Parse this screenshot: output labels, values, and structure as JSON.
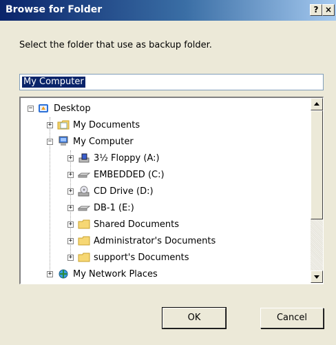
{
  "window": {
    "title": "Browse for Folder",
    "help_label": "?",
    "close_label": "×"
  },
  "instruction": "Select the folder that use as backup folder.",
  "selected_path": "My Computer",
  "tree": {
    "items": [
      {
        "label": "Desktop",
        "expander": "−",
        "icon": "desktop-icon"
      },
      {
        "label": "My Documents",
        "expander": "+",
        "icon": "my-documents-icon"
      },
      {
        "label": "My Computer",
        "expander": "−",
        "icon": "my-computer-icon"
      },
      {
        "label": "3½ Floppy (A:)",
        "expander": "+",
        "icon": "floppy-drive-icon"
      },
      {
        "label": "EMBEDDED (C:)",
        "expander": "+",
        "icon": "hard-drive-icon"
      },
      {
        "label": "CD Drive (D:)",
        "expander": "+",
        "icon": "cd-drive-icon"
      },
      {
        "label": "DB-1 (E:)",
        "expander": "+",
        "icon": "hard-drive-icon"
      },
      {
        "label": "Shared Documents",
        "expander": "+",
        "icon": "folder-icon"
      },
      {
        "label": "Administrator's Documents",
        "expander": "+",
        "icon": "folder-icon"
      },
      {
        "label": "support's Documents",
        "expander": "+",
        "icon": "folder-icon"
      },
      {
        "label": "My Network Places",
        "expander": "+",
        "icon": "network-places-icon"
      }
    ]
  },
  "buttons": {
    "ok": "OK",
    "cancel": "Cancel"
  },
  "colors": {
    "titlebar_start": "#0a246a",
    "titlebar_end": "#a6caf0",
    "dialog_bg": "#ece9d8",
    "selection": "#0a246a"
  }
}
